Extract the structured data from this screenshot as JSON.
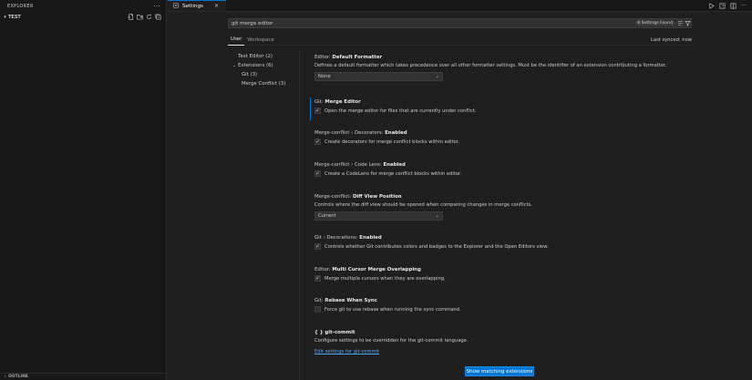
{
  "explorer": {
    "title": "EXPLORER",
    "more": "···",
    "folder": "TEST",
    "outline": "OUTLINE"
  },
  "tab": {
    "label": "Settings",
    "close": "×"
  },
  "search": {
    "value": "git merge editor",
    "found": "8 Settings Found"
  },
  "scopes": {
    "user": "User",
    "workspace": "Workspace",
    "synced": "Last synced: now"
  },
  "toc": [
    {
      "label": "Text Editor (2)"
    },
    {
      "label": "Extensions (6)"
    },
    {
      "label": "Git (3)"
    },
    {
      "label": "Merge Conflict (3)"
    }
  ],
  "settings": {
    "formatter": {
      "prefix": "Editor: ",
      "name": "Default Formatter",
      "desc": "Defines a default formatter which takes precedence over all other formatter settings. Must be the identifier of an extension contributing a formatter.",
      "value": "None"
    },
    "merge_editor": {
      "prefix": "Git: ",
      "name": "Merge Editor",
      "desc": "Open the merge editor for files that are currently under conflict.",
      "checked": true
    },
    "decorators": {
      "prefix": "Merge-conflict › Decorators: ",
      "name": "Enabled",
      "desc": "Create decorators for merge conflict blocks within editor.",
      "checked": true
    },
    "codelens": {
      "prefix": "Merge-conflict › Code Lens: ",
      "name": "Enabled",
      "desc": "Create a CodeLens for merge conflict blocks within editor.",
      "checked": true
    },
    "diff_view": {
      "prefix": "Merge-conflict: ",
      "name": "Diff View Position",
      "desc": "Controls where the diff view should be opened when comparing changes in merge conflicts.",
      "value": "Current"
    },
    "git_decorations": {
      "prefix": "Git › Decorations: ",
      "name": "Enabled",
      "desc": "Controls whether Git contributes colors and badges to the Explorer and the Open Editors view.",
      "checked": true
    },
    "multi_cursor": {
      "prefix": "Editor: ",
      "name": "Multi Cursor Merge Overlapping",
      "desc": "Merge multiple cursors when they are overlapping.",
      "checked": true
    },
    "rebase": {
      "prefix": "Git: ",
      "name": "Rebase When Sync",
      "desc": "Force git to use rebase when running the sync command.",
      "checked": false
    },
    "git_commit": {
      "heading": "{ } git-commit",
      "desc": "Configure settings to be overridden for the git-commit language.",
      "link": "Edit settings for git-commit"
    }
  },
  "button": {
    "label": "Show matching extensions"
  },
  "colors": {
    "accent": "#0078d4",
    "link": "#4daafc",
    "background": "#1f1f1f",
    "sidebar": "#181818"
  }
}
